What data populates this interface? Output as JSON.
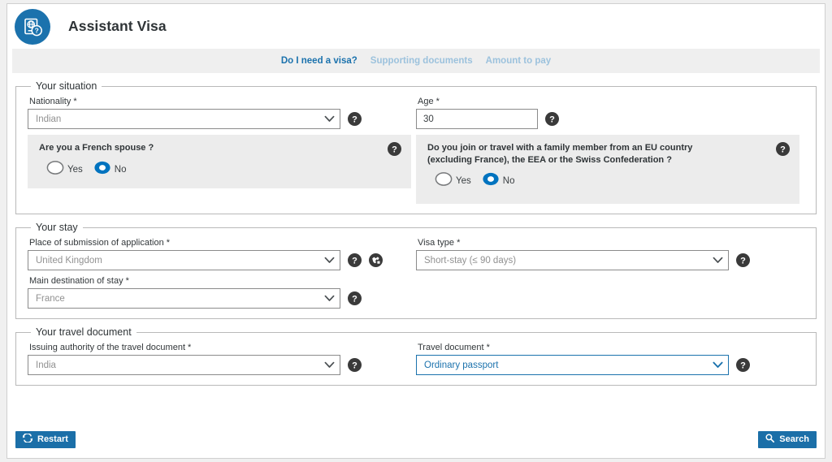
{
  "header": {
    "logo_icon": "passport-help-icon",
    "title": "Assistant Visa",
    "brand_color": "#1b72ad"
  },
  "tabs": [
    {
      "label": "Do I need a visa?",
      "state": "active"
    },
    {
      "label": "Supporting documents",
      "state": "disabled"
    },
    {
      "label": "Amount to pay",
      "state": "disabled"
    }
  ],
  "sections": {
    "situation": {
      "legend": "Your situation",
      "nationality": {
        "label": "Nationality *",
        "value": "Indian",
        "help_icon": "question-mark-icon"
      },
      "age": {
        "label": "Age *",
        "value": "30",
        "help_icon": "question-mark-icon"
      },
      "french_spouse": {
        "question": "Are you a French spouse ?",
        "help_icon": "question-mark-icon",
        "options": [
          "Yes",
          "No"
        ],
        "selected": "No"
      },
      "eu_family": {
        "question": "Do you join or travel with a family member from an EU country (excluding France), the EEA or the Swiss Confederation ?",
        "help_icon": "question-mark-icon",
        "options": [
          "Yes",
          "No"
        ],
        "selected": "No"
      }
    },
    "stay": {
      "legend": "Your stay",
      "place_of_submission": {
        "label": "Place of submission of application *",
        "value": "United Kingdom",
        "help_icon": "question-mark-icon",
        "extra_icon": "globe-icon"
      },
      "visa_type": {
        "label": "Visa type *",
        "value": "Short-stay (≤ 90 days)",
        "help_icon": "question-mark-icon"
      },
      "main_destination": {
        "label": "Main destination of stay *",
        "value": "France",
        "help_icon": "question-mark-icon"
      }
    },
    "travel_document": {
      "legend": "Your travel document",
      "issuing_authority": {
        "label": "Issuing authority of the travel document *",
        "value": "India",
        "help_icon": "question-mark-icon"
      },
      "document_type": {
        "label": "Travel document *",
        "value": "Ordinary passport",
        "help_icon": "question-mark-icon",
        "focused": true
      }
    }
  },
  "footer": {
    "restart_label": "Restart",
    "restart_icon": "refresh-icon",
    "search_label": "Search",
    "search_icon": "magnifier-icon",
    "button_color": "#1b6fa8"
  }
}
